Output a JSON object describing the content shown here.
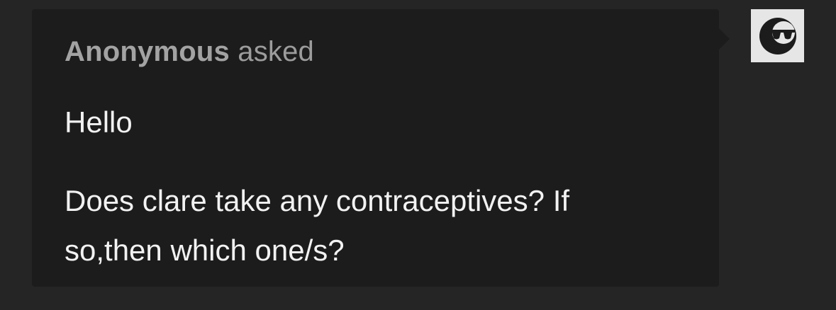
{
  "ask": {
    "asker_name": "Anonymous",
    "asked_word": "asked",
    "message_lines": [
      "Hello",
      "Does clare take any contraceptives? If so,then which one/s?"
    ]
  },
  "avatar": {
    "icon": "sunglasses-face-icon"
  },
  "colors": {
    "page_background": "#252525",
    "bubble_background": "#1c1c1c",
    "asker_text": "#9c9c9c",
    "message_text": "#f2f2f2"
  }
}
